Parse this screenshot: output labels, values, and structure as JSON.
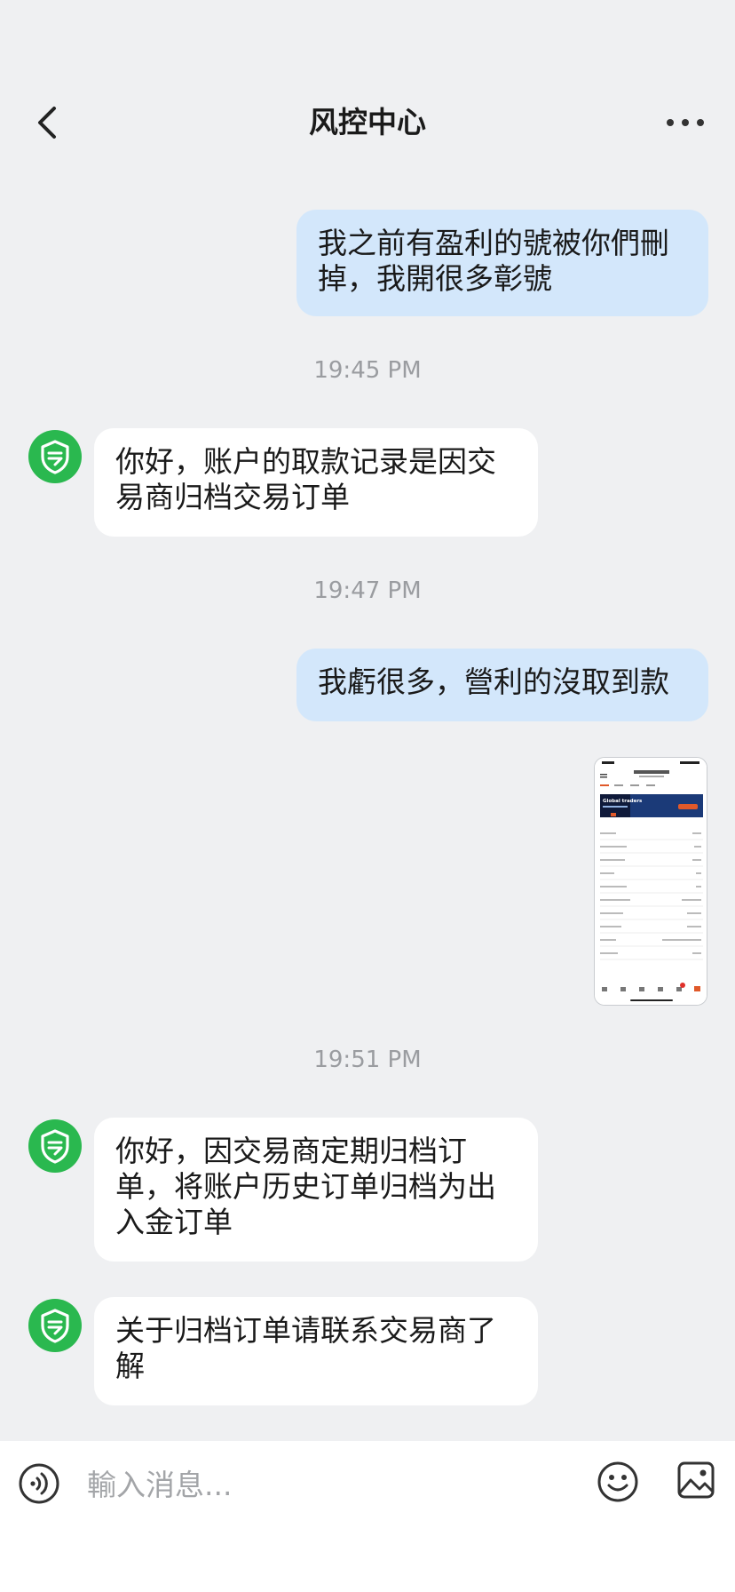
{
  "header": {
    "title": "风控中心",
    "back_icon": "chevron-left-icon",
    "more_icon": "more-horizontal-icon"
  },
  "messages": [
    {
      "type": "out",
      "text": "我之前有盈利的號被你們刪掉，我開很多彰號"
    },
    {
      "type": "timestamp",
      "text": "19:45 PM"
    },
    {
      "type": "in",
      "text": "你好，账户的取款记录是因交易商归档交易订单"
    },
    {
      "type": "timestamp",
      "text": "19:47 PM"
    },
    {
      "type": "out",
      "text": "我虧很多，營利的沒取到款"
    },
    {
      "type": "image",
      "banner_text": "Global traders"
    },
    {
      "type": "timestamp",
      "text": "19:51 PM"
    },
    {
      "type": "in",
      "text": "你好，因交易商定期归档订单，将账户历史订单归档为出入金订单"
    },
    {
      "type": "in",
      "text": "关于归档订单请联系交易商了解"
    }
  ],
  "input": {
    "placeholder": "輸入消息..."
  },
  "colors": {
    "background": "#eff0f2",
    "outgoing_bubble": "#d3e7fb",
    "incoming_bubble": "#ffffff",
    "avatar": "#2ab84f",
    "timestamp": "#9a9ca0"
  },
  "icons": {
    "avatar": "shield-check-icon",
    "voice": "voice-icon",
    "emoji": "emoji-icon",
    "image": "image-icon"
  }
}
